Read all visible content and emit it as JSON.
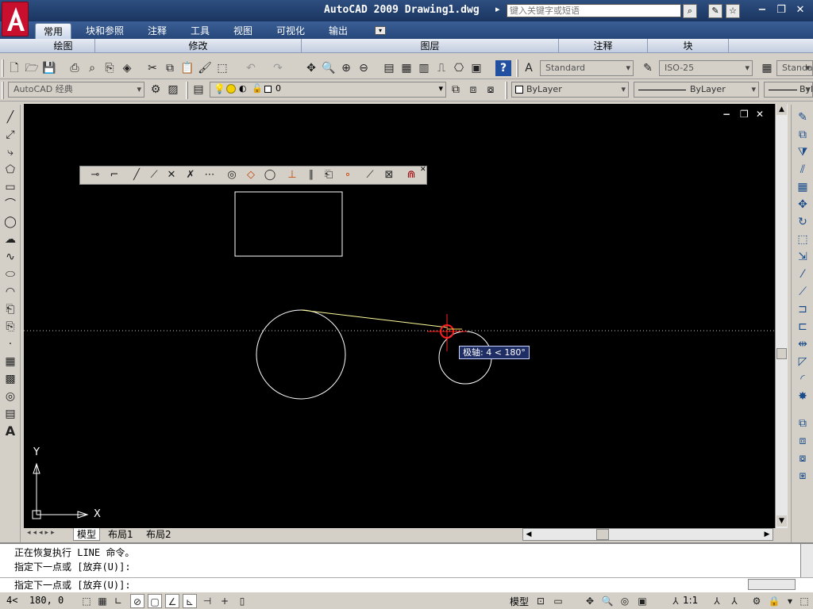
{
  "window": {
    "title": "AutoCAD 2009 Drawing1.dwg",
    "search_placeholder": "键入关键字或短语",
    "help_arrow": "▸",
    "minimize": "−",
    "restore": "❐",
    "close": "✕"
  },
  "ribbon": {
    "tabs": [
      {
        "label": "常用",
        "active": true
      },
      {
        "label": "块和参照"
      },
      {
        "label": "注释"
      },
      {
        "label": "工具"
      },
      {
        "label": "视图"
      },
      {
        "label": "可视化"
      },
      {
        "label": "输出"
      }
    ],
    "panels": [
      "绘图",
      "修改",
      "图层",
      "注释",
      "块"
    ]
  },
  "toolbar1": {
    "text_style": "Standard",
    "dim_style": "ISO-25",
    "table_style": "Standar"
  },
  "toolbar2": {
    "workspace": "AutoCAD 经典",
    "layer": "0",
    "color": "ByLayer",
    "linetype": "ByLayer",
    "lineweight": "Byl"
  },
  "canvas": {
    "inner_minimize": "−",
    "inner_restore": "❐",
    "inner_close": "✕",
    "ucs_x": "X",
    "ucs_y": "Y",
    "tooltip": "极轴: 4 < 180°"
  },
  "layout_tabs": [
    "模型",
    "布局1",
    "布局2"
  ],
  "command_window": {
    "lines": [
      "正在恢复执行 LINE 命令。",
      "指定下一点或 [放弃(U)]:"
    ],
    "prompt": "指定下一点或 [放弃(U)]:"
  },
  "statusbar": {
    "coords": "4<  180, 0",
    "space": "模型",
    "scale": "1:1"
  },
  "colors": {
    "canvas_bg": "#000000",
    "geometry": "#ffffff",
    "cursor": "#ff2020",
    "tooltip_bg": "#1e2e64",
    "logo": "#c8102e"
  }
}
